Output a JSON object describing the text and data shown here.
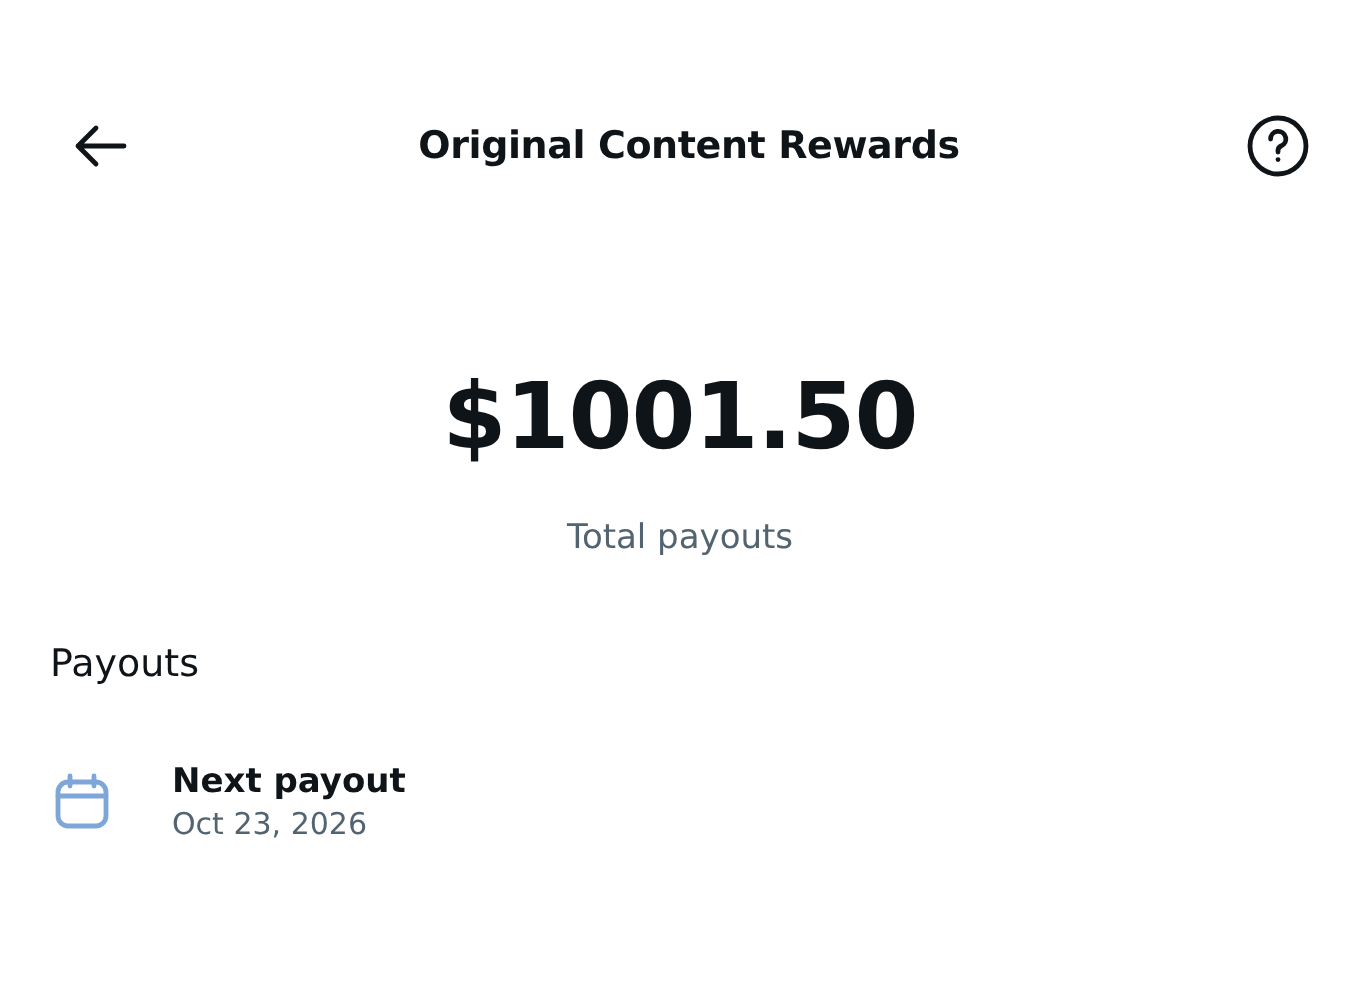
{
  "header": {
    "title": "Original Content Rewards"
  },
  "summary": {
    "amount": "$1001.50",
    "label": "Total payouts"
  },
  "payouts": {
    "heading": "Payouts",
    "items": [
      {
        "title": "Next payout",
        "date": "Oct 23, 2026"
      }
    ]
  }
}
